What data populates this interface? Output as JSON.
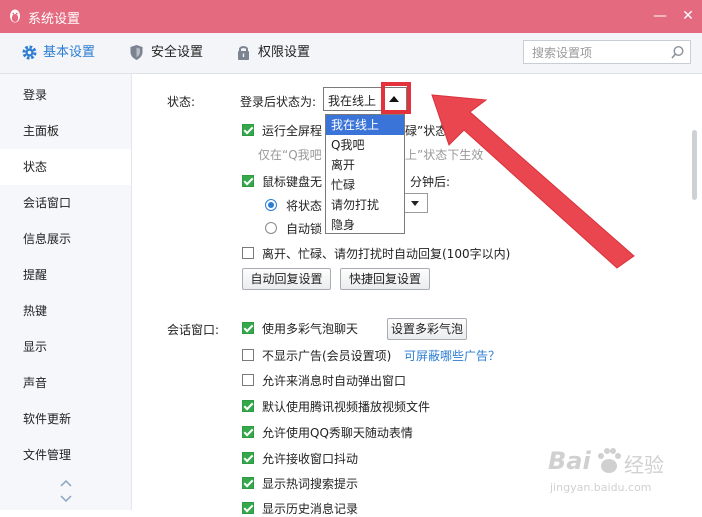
{
  "window": {
    "title": "系统设置",
    "minimize_glyph": "—",
    "close_glyph": "✕"
  },
  "toolbar": {
    "tabs": [
      {
        "label": "基本设置",
        "icon": "gear-icon",
        "active": true
      },
      {
        "label": "安全设置",
        "icon": "shield-icon",
        "active": false
      },
      {
        "label": "权限设置",
        "icon": "lock-icon",
        "active": false
      }
    ],
    "search_placeholder": "搜索设置项"
  },
  "sidebar": {
    "items": [
      {
        "label": "登录"
      },
      {
        "label": "主面板"
      },
      {
        "label": "状态",
        "active": true
      },
      {
        "label": "会话窗口"
      },
      {
        "label": "信息展示"
      },
      {
        "label": "提醒"
      },
      {
        "label": "热键"
      },
      {
        "label": "显示"
      },
      {
        "label": "声音"
      },
      {
        "label": "软件更新"
      },
      {
        "label": "文件管理"
      }
    ]
  },
  "status_section": {
    "heading": "状态:",
    "login_status_label": "登录后状态为:",
    "login_status_value": "我在线上",
    "dropdown_options": [
      "我在线上",
      "Q我吧",
      "离开",
      "忙碌",
      "请勿打扰",
      "隐身"
    ],
    "fullscreen_prefix": "运行全屏程",
    "fullscreen_suffix": "碌”状态",
    "fullscreen_hint_prefix": "仅在“Q我吧",
    "fullscreen_hint_suffix": "上”状态下生效",
    "idle_prefix": "鼠标键盘无",
    "idle_suffix": "分钟后:",
    "radio_status_prefix": "将状态",
    "radio_auto_prefix": "自动锁",
    "auto_reply_label": "离开、忙碌、请勿打扰时自动回复(100字以内)",
    "auto_reply_button": "自动回复设置",
    "quick_reply_button": "快捷回复设置"
  },
  "session_section": {
    "heading": "会话窗口:",
    "options": [
      {
        "label": "使用多彩气泡聊天",
        "checked": true
      },
      {
        "label": "不显示广告(会员设置项)",
        "checked": false
      },
      {
        "label": "允许来消息时自动弹出窗口",
        "checked": false
      },
      {
        "label": "默认使用腾讯视频播放视频文件",
        "checked": true
      },
      {
        "label": "允许使用QQ秀聊天随动表情",
        "checked": true
      },
      {
        "label": "允许接收窗口抖动",
        "checked": true
      },
      {
        "label": "显示热词搜索提示",
        "checked": true
      },
      {
        "label": "显示历史消息记录",
        "checked": true
      }
    ],
    "bubble_button": "设置多彩气泡",
    "ads_link": "可屏蔽哪些广告？"
  },
  "watermark": {
    "brand": "Bai",
    "brand_cn": "经验",
    "url": "jingyan.baidu.com"
  },
  "colors": {
    "title_bar": "#e46a7f",
    "accent": "#2c7dd2",
    "checkbox_green": "#35a84b",
    "annotation_red": "#e3323c",
    "selection_blue": "#3b74d9"
  }
}
